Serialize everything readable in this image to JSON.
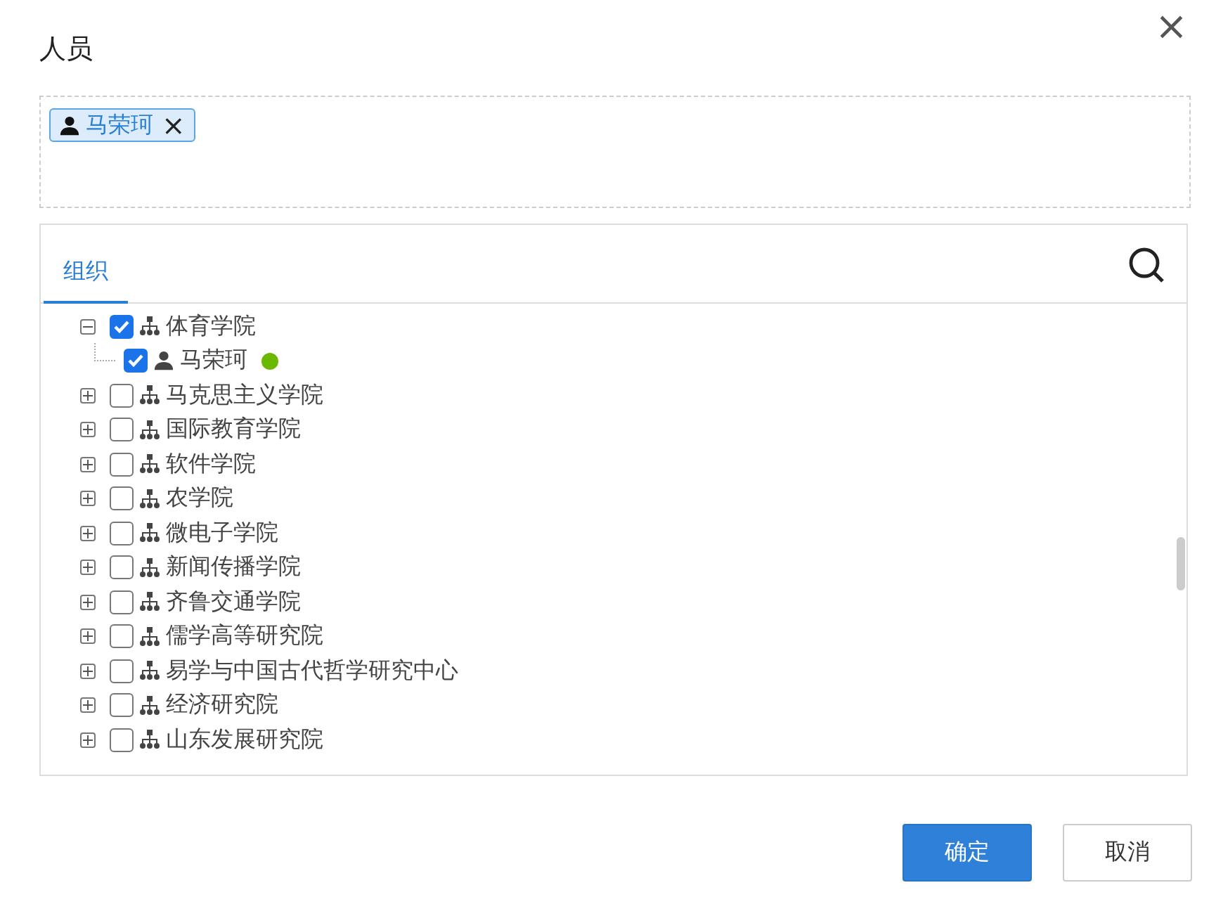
{
  "dialog": {
    "title": "人员",
    "close": "×"
  },
  "selected_people": [
    {
      "name": "马荣珂",
      "remove": "×"
    }
  ],
  "tabs": [
    {
      "label": "组织",
      "selected": true
    }
  ],
  "tree": [
    {
      "kind": "org",
      "label": "体育学院",
      "expanded": true,
      "checked": true,
      "children": [
        {
          "kind": "person",
          "label": "马荣珂",
          "checked": true,
          "online": true
        }
      ]
    },
    {
      "kind": "org",
      "label": "马克思主义学院",
      "expanded": false,
      "checked": false
    },
    {
      "kind": "org",
      "label": "国际教育学院",
      "expanded": false,
      "checked": false
    },
    {
      "kind": "org",
      "label": "软件学院",
      "expanded": false,
      "checked": false
    },
    {
      "kind": "org",
      "label": "农学院",
      "expanded": false,
      "checked": false
    },
    {
      "kind": "org",
      "label": "微电子学院",
      "expanded": false,
      "checked": false
    },
    {
      "kind": "org",
      "label": "新闻传播学院",
      "expanded": false,
      "checked": false
    },
    {
      "kind": "org",
      "label": "齐鲁交通学院",
      "expanded": false,
      "checked": false
    },
    {
      "kind": "org",
      "label": "儒学高等研究院",
      "expanded": false,
      "checked": false
    },
    {
      "kind": "org",
      "label": "易学与中国古代哲学研究中心",
      "expanded": false,
      "checked": false
    },
    {
      "kind": "org",
      "label": "经济研究院",
      "expanded": false,
      "checked": false
    },
    {
      "kind": "org",
      "label": "山东发展研究院",
      "expanded": false,
      "checked": false
    }
  ],
  "buttons": [
    {
      "label": "确定",
      "kind": "primary"
    },
    {
      "label": "取消",
      "kind": "default"
    }
  ]
}
